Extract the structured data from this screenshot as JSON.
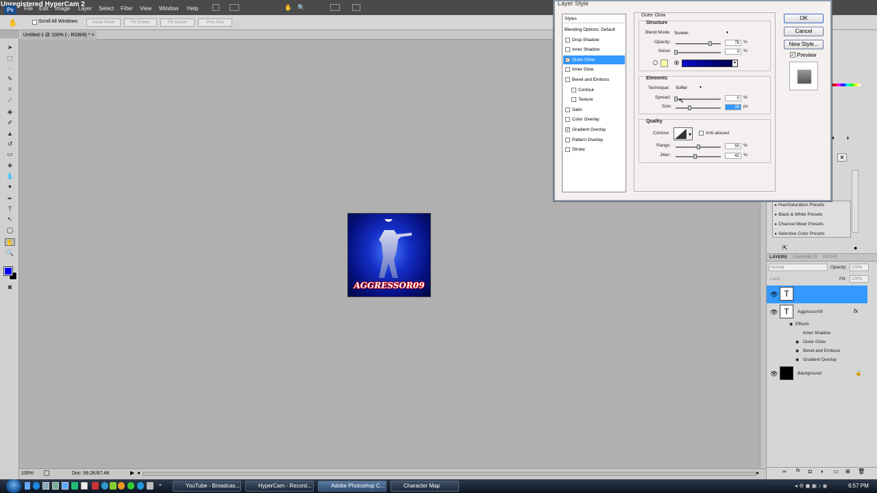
{
  "app": {
    "recorder_watermark": "Unregistered HyperCam 2",
    "ps_logo": "Ps",
    "menu": [
      "File",
      "Edit",
      "Image",
      "Layer",
      "Select",
      "Filter",
      "View",
      "Window",
      "Help"
    ]
  },
  "options_bar": {
    "scroll_all_windows": "Scroll All Windows",
    "buttons": [
      "Actual Pixels",
      "Fit Screen",
      "Fill Screen",
      "Print Size"
    ]
  },
  "document": {
    "tab_title": "Untitled-1 @ 100% (-, RGB/8) *",
    "image_text": "AGGRESSOR09",
    "zoom": "100%",
    "doc_size": "Doc: 99.2K/67.4K"
  },
  "dialog": {
    "title": "Layer Style",
    "styles_header": "Styles",
    "styles": [
      {
        "label": "Blending Options: Default",
        "checkbox": false,
        "checked": false,
        "selected": false,
        "sub": false
      },
      {
        "label": "Drop Shadow",
        "checkbox": true,
        "checked": false,
        "selected": false,
        "sub": false
      },
      {
        "label": "Inner Shadow",
        "checkbox": true,
        "checked": false,
        "selected": false,
        "sub": false
      },
      {
        "label": "Outer Glow",
        "checkbox": true,
        "checked": true,
        "selected": true,
        "sub": false
      },
      {
        "label": "Inner Glow",
        "checkbox": true,
        "checked": false,
        "selected": false,
        "sub": false
      },
      {
        "label": "Bevel and Emboss",
        "checkbox": true,
        "checked": false,
        "selected": false,
        "sub": false
      },
      {
        "label": "Contour",
        "checkbox": true,
        "checked": false,
        "selected": false,
        "sub": true
      },
      {
        "label": "Texture",
        "checkbox": true,
        "checked": false,
        "selected": false,
        "sub": true
      },
      {
        "label": "Satin",
        "checkbox": true,
        "checked": false,
        "selected": false,
        "sub": false
      },
      {
        "label": "Color Overlay",
        "checkbox": true,
        "checked": false,
        "selected": false,
        "sub": false
      },
      {
        "label": "Gradient Overlay",
        "checkbox": true,
        "checked": true,
        "selected": false,
        "sub": false
      },
      {
        "label": "Pattern Overlay",
        "checkbox": true,
        "checked": false,
        "selected": false,
        "sub": false
      },
      {
        "label": "Stroke",
        "checkbox": true,
        "checked": false,
        "selected": false,
        "sub": false
      }
    ],
    "outer_glow": {
      "title": "Outer Glow",
      "structure": "Structure",
      "blend_mode_label": "Blend Mode:",
      "blend_mode": "Screen",
      "opacity_label": "Opacity:",
      "opacity": "75",
      "noise_label": "Noise:",
      "noise": "0",
      "pct": "%",
      "elements": "Elements",
      "technique_label": "Technique:",
      "technique": "Softer",
      "spread_label": "Spread:",
      "spread": "0",
      "size_label": "Size:",
      "size": "35",
      "px": "px",
      "quality": "Quality",
      "contour_label": "Contour:",
      "anti_aliased": "Anti-aliased",
      "range_label": "Range:",
      "range": "50",
      "jitter_label": "Jitter:",
      "jitter": "42",
      "glow_color": "#0a0ac8",
      "swatch_color": "#ffffa8",
      "opacity_level": 0.75,
      "noise_level": 0,
      "spread_level": 0,
      "size_level": 0.3,
      "range_level": 0.5,
      "jitter_level": 0.42
    },
    "buttons": {
      "ok": "OK",
      "cancel": "Cancel",
      "new_style": "New Style...",
      "preview": "Preview"
    }
  },
  "adjustments": [
    "Hue/Saturation Presets",
    "Black & White Presets",
    "Channel Mixer Presets",
    "Selective Color Presets"
  ],
  "layers_panel": {
    "tabs": [
      "LAYERS",
      "CHANNELS",
      "PATHS"
    ],
    "blend": "Normal",
    "opacity_label": "Opacity:",
    "opacity": "100%",
    "lock_label": "Lock:",
    "fill_label": "Fill:",
    "fill": "100%",
    "layers": [
      {
        "name": "-",
        "type": "T"
      },
      {
        "name": "Aggressor09",
        "type": "T"
      }
    ],
    "effects_label": "Effects",
    "effects": [
      "Inner Shadow",
      "Outer Glow",
      "Bevel and Emboss",
      "Gradient Overlay"
    ],
    "background": "Background"
  },
  "taskbar": {
    "items": [
      "YouTube - Broadcas...",
      "HyperCam - Record...",
      "Adobe Photoshop C...",
      "Character Map"
    ],
    "active_index": 2,
    "clock": "6:57 PM"
  },
  "colors": {
    "accent": "#3399ff",
    "foreground": "#0000ff",
    "background_swatch": "#000000"
  }
}
